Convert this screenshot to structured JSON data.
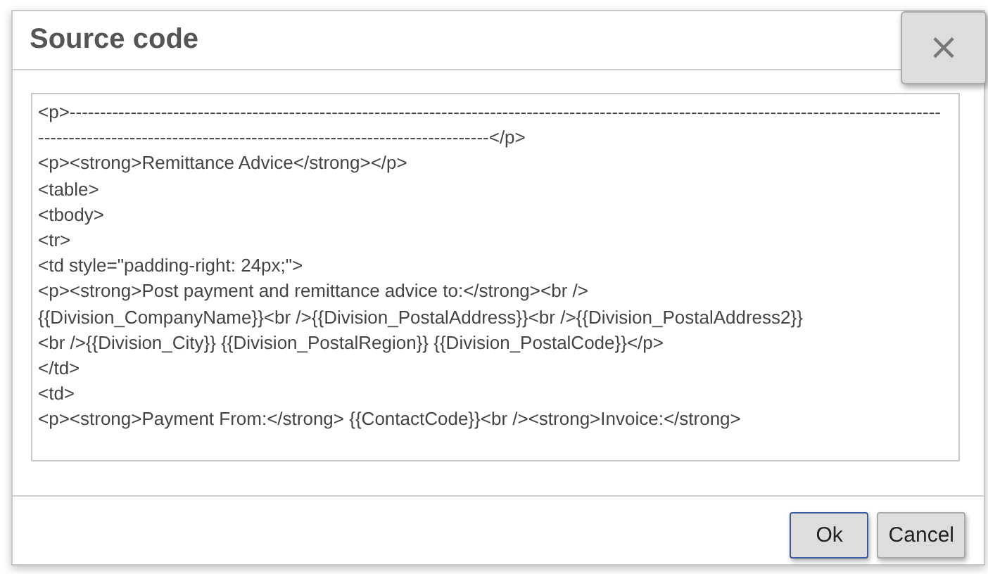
{
  "dialog": {
    "title": "Source code",
    "close_label": "×",
    "code_lines": [
      "<p>-----------------------------------------------------------------------------------------------------------------------------------------------",
      "--------------------------------------------------------------------------</p>",
      "<p><strong>Remittance Advice</strong></p>",
      "<table>",
      "<tbody>",
      "<tr>",
      "<td style=\"padding-right: 24px;\">",
      "<p><strong>Post payment and remittance advice to:</strong><br />",
      "{{Division_CompanyName}}<br />{{Division_PostalAddress}}<br />{{Division_PostalAddress2}}",
      "<br />{{Division_City}} {{Division_PostalRegion}} {{Division_PostalCode}}</p>",
      "</td>",
      "<td>",
      "<p><strong>Payment From:</strong> {{ContactCode}}<br /><strong>Invoice:</strong>"
    ],
    "buttons": [
      {
        "label": "Ok",
        "kind": "primary"
      },
      {
        "label": "Cancel",
        "kind": "secondary"
      }
    ]
  }
}
